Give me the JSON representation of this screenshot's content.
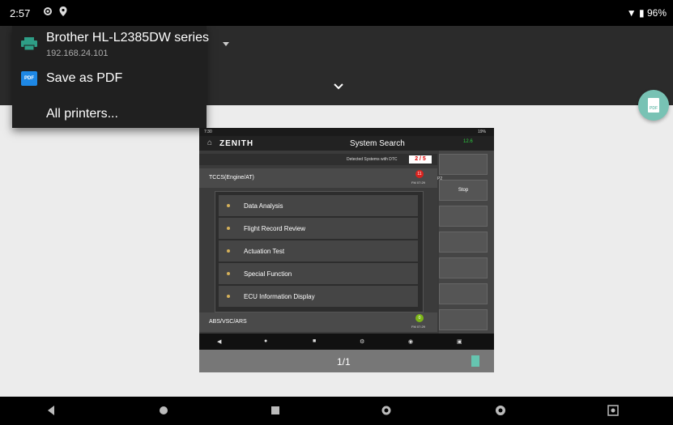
{
  "status_bar": {
    "time": "2:57",
    "battery": "96%"
  },
  "printer_menu": {
    "items": [
      {
        "name": "Brother HL-L2385DW series",
        "address": "192.168.24.101"
      },
      {
        "name": "Save as PDF"
      },
      {
        "name": "All printers..."
      }
    ]
  },
  "preview": {
    "status_time": "7:30",
    "status_right": "19%",
    "brand": "ZENITH",
    "title": "System Search",
    "battery_right": "12.6",
    "dtc_label": "Detected Systems with DTC",
    "dtc_value": "2 / 5",
    "ecus": [
      {
        "name": "TCCS(Engine/AT)",
        "badge": "11",
        "badge_color": "#d9231f",
        "fm": "FM 07:29"
      },
      {
        "name": "ABS/VSC/ARS",
        "badge": "0",
        "badge_color": "#7cb518",
        "fm": "FM 07:29"
      }
    ],
    "submenu": [
      "Data Analysis",
      "Flight Record Review",
      "Actuation Test",
      "Special Function",
      "ECU Information Display"
    ],
    "side": {
      "stop_label": "Stop",
      "marker": "P2"
    },
    "page": "1/1"
  },
  "colors": {
    "accent": "#78c2b4",
    "header_bg": "#2b2b2b",
    "menu_bg": "#202020"
  }
}
